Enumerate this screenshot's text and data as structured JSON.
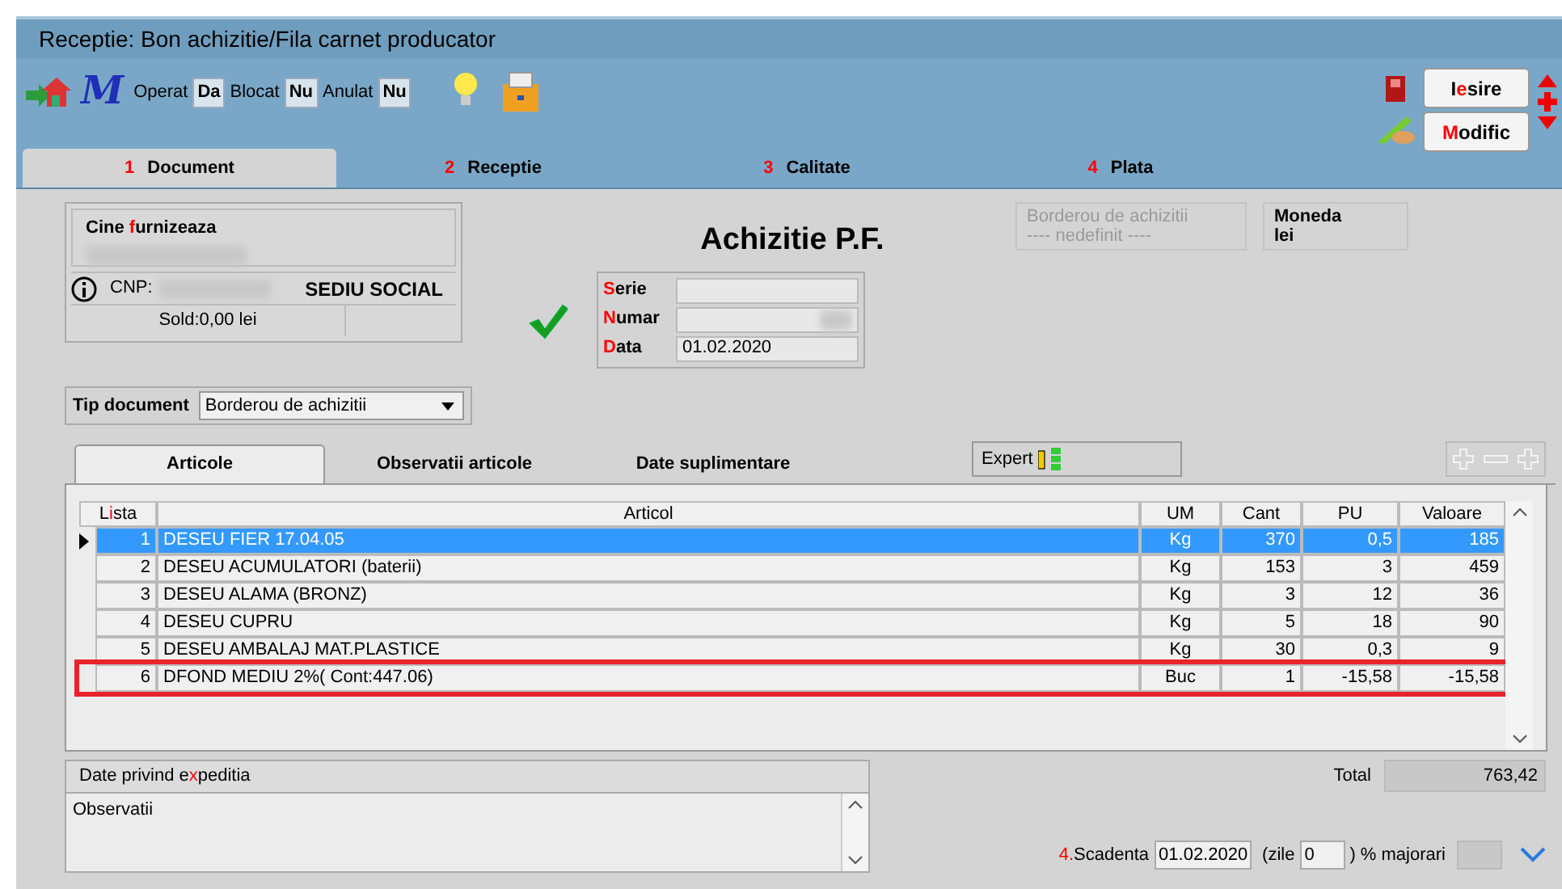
{
  "window": {
    "title": "Receptie: Bon achizitie/Fila carnet producator"
  },
  "toolbar": {
    "logo": "M",
    "flags": [
      {
        "label": "Operat",
        "value": "Da"
      },
      {
        "label": "Blocat",
        "value": "Nu"
      },
      {
        "label": "Anulat",
        "value": "Nu"
      }
    ]
  },
  "buttons": [
    {
      "pre": "I",
      "key": "e",
      "post": "sire"
    },
    {
      "key": "M",
      "post": "odific"
    }
  ],
  "tabs": [
    {
      "number": "1",
      "label": "Document",
      "selected": true
    },
    {
      "number": "2",
      "label": "Receptie",
      "selected": false
    },
    {
      "number": "3",
      "label": "Calitate",
      "selected": false
    },
    {
      "number": "4",
      "label": "Plata",
      "selected": false
    }
  ],
  "supplier": {
    "label": {
      "pre": "Cine ",
      "key": "f",
      "post": "urnizeaza"
    },
    "cnp_label": "CNP:",
    "sediu": "SEDIU SOCIAL",
    "sold": "Sold:0,00 lei"
  },
  "doc_title": "Achizitie P.F.",
  "doc_fields": [
    {
      "label": {
        "key": "S",
        "post": "erie"
      },
      "redacted": false
    },
    {
      "label": {
        "key": "N",
        "post": "umar"
      },
      "redacted": true
    },
    {
      "label": {
        "key": "D",
        "post": "ata"
      },
      "value": "01.02.2020",
      "redacted": false
    }
  ],
  "info_boxes": [
    {
      "lines": [
        "Borderou de achizitii",
        "---- nedefinit ----"
      ],
      "disabled": true
    },
    {
      "lines": [
        "Moneda",
        "lei"
      ],
      "disabled": false
    }
  ],
  "tip_document": {
    "label": "Tip document",
    "value": "Borderou de achizitii"
  },
  "subtabs": [
    {
      "label": "Articole",
      "selected": true
    },
    {
      "label": "Observatii articole",
      "selected": false
    },
    {
      "label": "Date suplimentare",
      "selected": false
    }
  ],
  "expert": "Expert",
  "table": {
    "columns": [
      {
        "pre": "L",
        "key": "i",
        "post": "sta"
      },
      {
        "pre": "Articol"
      },
      {
        "pre": "UM"
      },
      {
        "pre": "Cant"
      },
      {
        "pre": "PU"
      },
      {
        "pre": "Valoare"
      }
    ],
    "rows": [
      {
        "cells": [
          "1",
          "DESEU FIER 17.04.05",
          "Kg",
          "370",
          "0,5",
          "185"
        ],
        "selected": true,
        "flagged": false
      },
      {
        "cells": [
          "2",
          "DESEU ACUMULATORI (baterii)",
          "Kg",
          "153",
          "3",
          "459"
        ],
        "selected": false,
        "flagged": false
      },
      {
        "cells": [
          "3",
          "DESEU ALAMA (BRONZ)",
          "Kg",
          "3",
          "12",
          "36"
        ],
        "selected": false,
        "flagged": false
      },
      {
        "cells": [
          "4",
          "DESEU CUPRU",
          "Kg",
          "5",
          "18",
          "90"
        ],
        "selected": false,
        "flagged": false
      },
      {
        "cells": [
          "5",
          "DESEU AMBALAJ MAT.PLASTICE",
          "Kg",
          "30",
          "0,3",
          "9"
        ],
        "selected": false,
        "flagged": false
      },
      {
        "cells": [
          "6",
          "DFOND MEDIU 2%( Cont:447.06)",
          "Buc",
          "1",
          "-15,58",
          "-15,58"
        ],
        "selected": false,
        "flagged": true
      }
    ]
  },
  "expedition": {
    "title": {
      "pre": "Date privind e",
      "key": "x",
      "post": "peditia"
    },
    "observatii": "Observatii"
  },
  "total": {
    "label": "Total",
    "value": "763,42"
  },
  "scadenta": {
    "number": "4.",
    "label": "Scadenta",
    "date": "01.02.2020",
    "zile_label": "(zile",
    "zile": "0",
    "majorari_label": ") % majorari"
  }
}
